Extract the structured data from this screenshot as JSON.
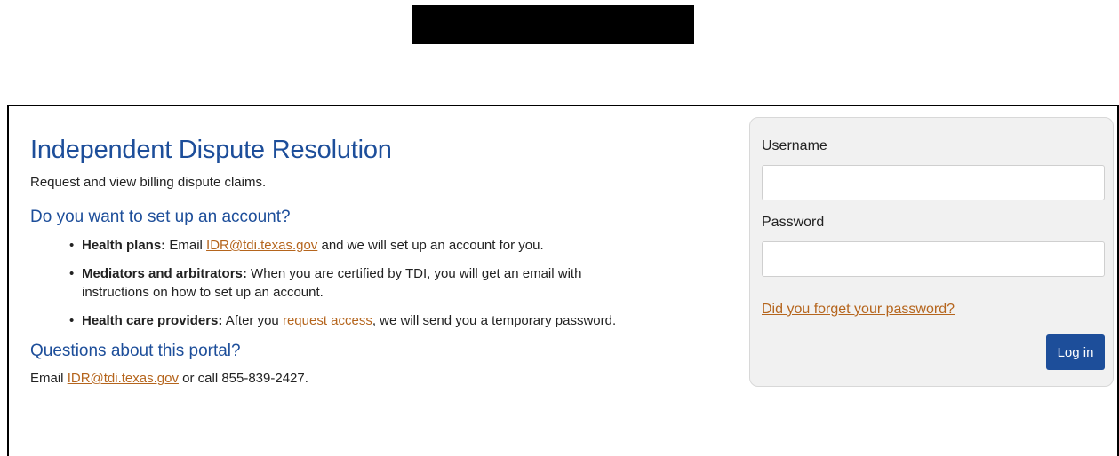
{
  "page": {
    "title": "Independent Dispute Resolution",
    "subtitle": "Request and view billing dispute claims."
  },
  "account_section": {
    "heading": "Do you want to set up an account?",
    "items": [
      {
        "label": "Health plans:",
        "text_before": " Email ",
        "link": "IDR@tdi.texas.gov",
        "text_after": " and we will set up an account for you."
      },
      {
        "label": "Mediators and arbitrators:",
        "text": " When you are certified by TDI, you will get an email with instructions on how to set up an account."
      },
      {
        "label": "Health care providers:",
        "text_before": " After you ",
        "link": "request access",
        "text_after": ", we will send you a temporary password."
      }
    ]
  },
  "questions_section": {
    "heading": "Questions about this portal?",
    "text_before": "Email ",
    "link": "IDR@tdi.texas.gov",
    "text_after": " or call 855-839-2427."
  },
  "login": {
    "username_label": "Username",
    "username_value": "",
    "password_label": "Password",
    "password_value": "",
    "forgot_link": "Did you forget your password?",
    "submit_label": "Log in"
  },
  "colors": {
    "heading": "#1d4e9a",
    "link": "#b5651d",
    "button": "#1d4e9a",
    "panel": "#f1f1f1",
    "redaction": "#000000"
  }
}
